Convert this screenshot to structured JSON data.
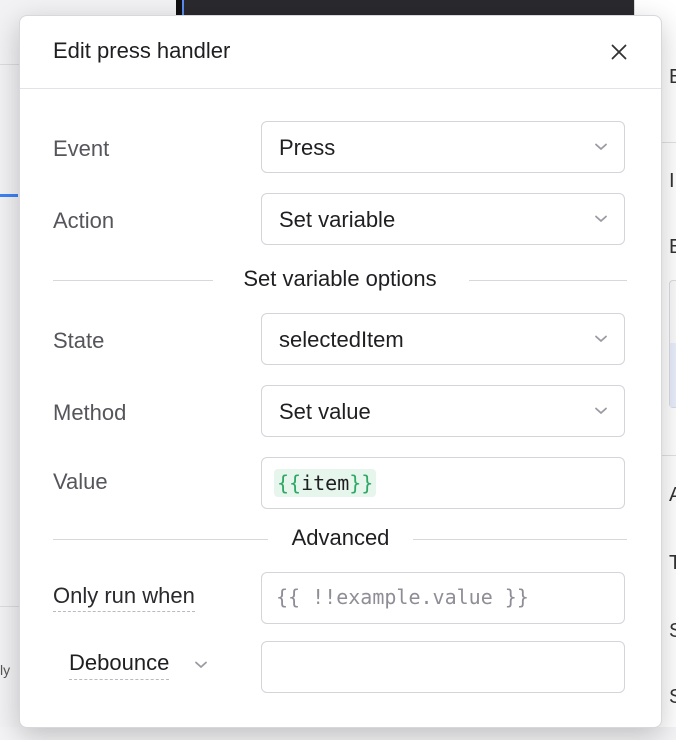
{
  "modal": {
    "title": "Edit press handler"
  },
  "fields": {
    "event": {
      "label": "Event",
      "value": "Press"
    },
    "action": {
      "label": "Action",
      "value": "Set variable"
    },
    "section_options": "Set variable options",
    "state": {
      "label": "State",
      "value": "selectedItem"
    },
    "method": {
      "label": "Method",
      "value": "Set value"
    },
    "value": {
      "label": "Value",
      "open": "{{",
      "token": "item",
      "close": "}}"
    },
    "section_advanced": "Advanced",
    "only_run_when": {
      "label": "Only run when",
      "placeholder": "{{ !!example.value }}"
    },
    "debounce": {
      "label": "Debounce",
      "value": ""
    }
  },
  "background": {
    "left_snippet": "ly",
    "right_letters": [
      "E",
      "I",
      "E",
      "A",
      "T",
      "S",
      "S"
    ]
  },
  "colors": {
    "token_bg": "#e6f6ec",
    "token_brace": "#2fa865",
    "accent": "#3b82f6"
  },
  "icons": {
    "close": "close-icon",
    "select": "chevron-down-icon"
  }
}
